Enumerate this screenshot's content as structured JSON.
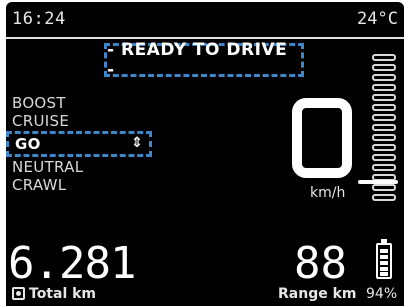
{
  "status": {
    "time": "16:24",
    "temperature": "24°C"
  },
  "banner": {
    "text": "- READY TO DRIVE -"
  },
  "modes": {
    "items": [
      "BOOST",
      "CRUISE",
      "GO",
      "NEUTRAL",
      "CRAWL"
    ],
    "selected": "GO",
    "selector_glyph": "⇕"
  },
  "speed": {
    "value_shape": "0",
    "unit": "km/h"
  },
  "odometer": {
    "value": "6.281",
    "label": "Total km",
    "icon": "odometer-icon"
  },
  "range": {
    "value": "88",
    "label": "Range km"
  },
  "battery": {
    "percent_text": "94%",
    "icon": "battery-icon"
  },
  "colors": {
    "focus": "#3f86c8",
    "background": "#000000",
    "foreground": "#ffffff"
  }
}
